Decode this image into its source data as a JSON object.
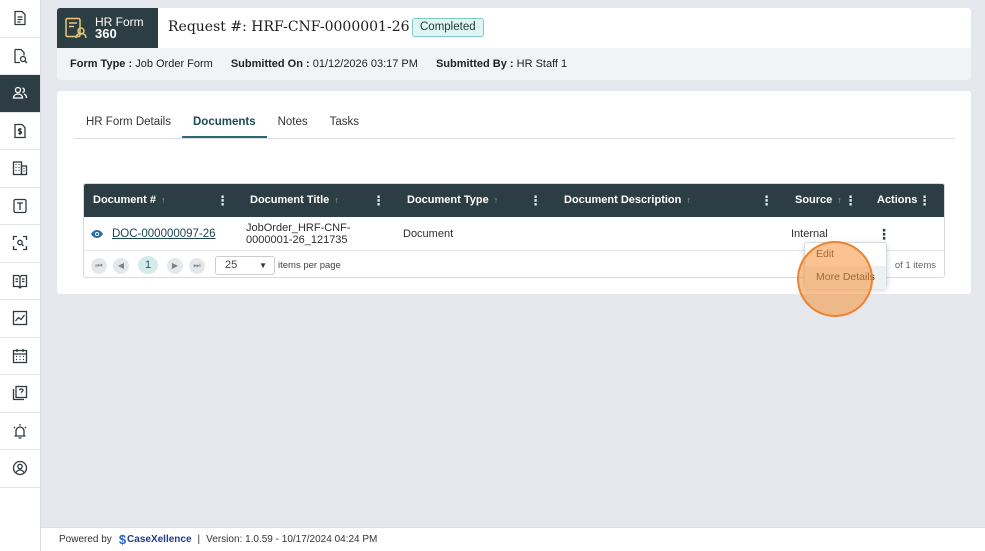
{
  "sidebar": {
    "items": [
      {
        "icon": "document-icon",
        "active": false
      },
      {
        "icon": "document-search-icon",
        "active": false
      },
      {
        "icon": "users-icon",
        "active": true
      },
      {
        "icon": "dollar-document-icon",
        "active": false
      },
      {
        "icon": "building-icon",
        "active": false
      },
      {
        "icon": "text-template-icon",
        "active": false
      },
      {
        "icon": "scan-icon",
        "active": false
      },
      {
        "icon": "book-icon",
        "active": false
      },
      {
        "icon": "chart-icon",
        "active": false
      },
      {
        "icon": "calendar-icon",
        "active": false
      },
      {
        "icon": "help-document-icon",
        "active": false
      },
      {
        "icon": "alarm-icon",
        "active": false
      },
      {
        "icon": "user-circle-icon",
        "active": false
      }
    ]
  },
  "header": {
    "brand_line1": "HR Form",
    "brand_line2": "360",
    "request_prefix": "Request #:",
    "request_id": "HRF-CNF-0000001-26",
    "status": "Completed",
    "form_type_label": "Form Type :",
    "form_type_value": "Job Order Form",
    "submitted_on_label": "Submitted On :",
    "submitted_on_value": "01/12/2026 03:17 PM",
    "submitted_by_label": "Submitted By :",
    "submitted_by_value": "HR Staff 1"
  },
  "tabs": [
    {
      "label": "HR Form Details",
      "active": false
    },
    {
      "label": "Documents",
      "active": true
    },
    {
      "label": "Notes",
      "active": false
    },
    {
      "label": "Tasks",
      "active": false
    }
  ],
  "grid": {
    "columns": [
      "Document #",
      "Document Title",
      "Document Type",
      "Document Description",
      "Source",
      "Actions"
    ],
    "rows": [
      {
        "doc_number": "DOC-000000097-26",
        "title_line1": "JobOrder_HRF-CNF-",
        "title_line2": "0000001-26_121735",
        "type": "Document",
        "description": "",
        "source": "Internal"
      }
    ],
    "pager": {
      "current_page": "1",
      "page_size": "25",
      "per_page_label": "items per page",
      "count_text": "of 1 items"
    }
  },
  "action_menu": {
    "items": [
      "Edit",
      "More Details"
    ]
  },
  "footer": {
    "powered_by": "Powered by",
    "logo_text": "CaseXellence",
    "separator": "|",
    "version": "Version: 1.0.59 - 10/17/2024 04:24 PM"
  },
  "colors": {
    "primary_dark": "#2c3e44",
    "status_badge_bg": "#dff5f4",
    "click_highlight": "#f59137"
  }
}
